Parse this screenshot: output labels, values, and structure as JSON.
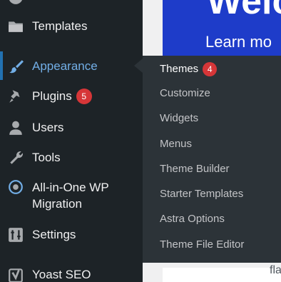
{
  "banner": {
    "big_text": "Welc",
    "link_text": "Learn mo"
  },
  "partial_text": "fla",
  "sidebar": {
    "items": [
      {
        "label": "Templates",
        "icon": "folder-icon"
      },
      {
        "label": "Appearance",
        "icon": "paintbrush-icon",
        "active": true
      },
      {
        "label": "Plugins",
        "icon": "plugin-icon",
        "badge": "5"
      },
      {
        "label": "Users",
        "icon": "user-icon"
      },
      {
        "label": "Tools",
        "icon": "wrench-icon"
      },
      {
        "label": "All-in-One WP",
        "label2": "Migration",
        "icon": "migration-icon"
      },
      {
        "label": "Settings",
        "icon": "settings-icon"
      },
      {
        "label": "Yoast SEO",
        "icon": "yoast-icon"
      }
    ]
  },
  "submenu": {
    "items": [
      {
        "label": "Themes",
        "badge": "4"
      },
      {
        "label": "Customize"
      },
      {
        "label": "Widgets"
      },
      {
        "label": "Menus"
      },
      {
        "label": "Theme Builder"
      },
      {
        "label": "Starter Templates"
      },
      {
        "label": "Astra Options"
      },
      {
        "label": "Theme File Editor"
      }
    ]
  },
  "colors": {
    "sidebar_bg": "#1d2327",
    "submenu_bg": "#2c3338",
    "active_text": "#72aee6",
    "badge": "#d63638",
    "banner": "#1e3cc9"
  }
}
